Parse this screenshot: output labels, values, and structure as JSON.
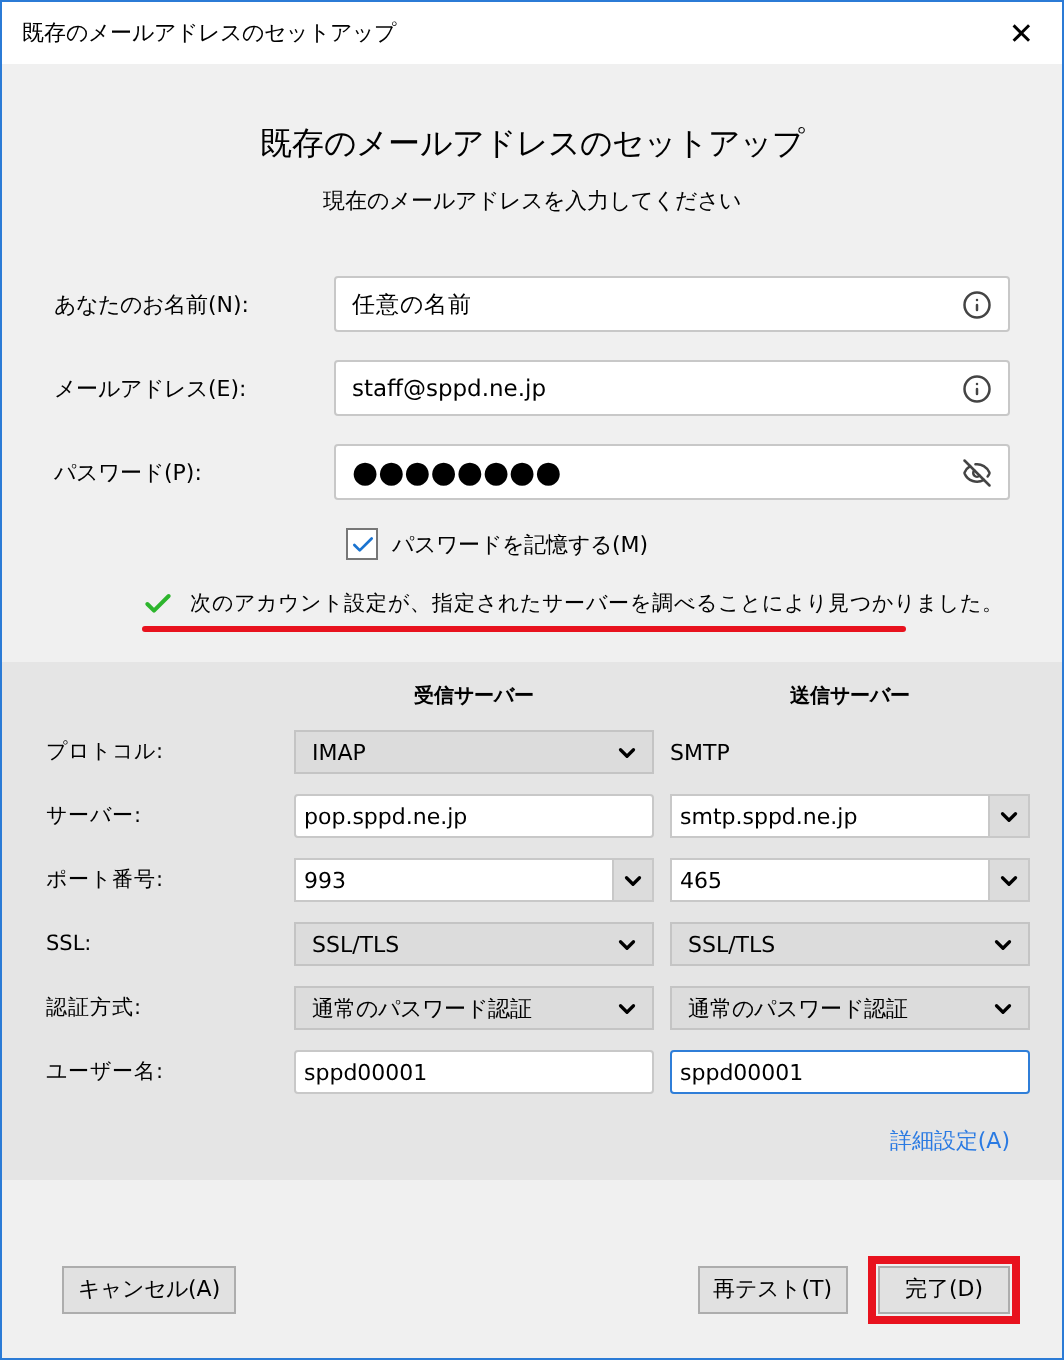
{
  "window": {
    "title": "既存のメールアドレスのセットアップ",
    "close": "✕"
  },
  "heading": "既存のメールアドレスのセットアップ",
  "subheading": "現在のメールアドレスを入力してください",
  "fields": [
    {
      "label": "あなたのお名前(N):",
      "value": "任意の名前",
      "kind": "text"
    },
    {
      "label": "メールアドレス(E):",
      "value": "staff@sppd.ne.jp",
      "kind": "text"
    },
    {
      "label": "パスワード(P):",
      "value": "●●●●●●●●",
      "kind": "password"
    }
  ],
  "remember": {
    "label": "パスワードを記憶する(M)",
    "checked": true
  },
  "status": {
    "text": "次のアカウント設定が、指定されたサーバーを調べることにより見つかりました。",
    "highlighted": true
  },
  "servers": {
    "columns": [
      "受信サーバー",
      "送信サーバー"
    ],
    "rows": [
      {
        "label": "プロトコル:",
        "incoming": {
          "kind": "select",
          "value": "IMAP"
        },
        "outgoing": {
          "kind": "text",
          "value": "SMTP"
        }
      },
      {
        "label": "サーバー:",
        "incoming": {
          "kind": "input",
          "value": "pop.sppd.ne.jp"
        },
        "outgoing": {
          "kind": "combo",
          "value": "smtp.sppd.ne.jp"
        }
      },
      {
        "label": "ポート番号:",
        "incoming": {
          "kind": "combo",
          "value": "993"
        },
        "outgoing": {
          "kind": "combo",
          "value": "465"
        }
      },
      {
        "label": "SSL:",
        "incoming": {
          "kind": "select",
          "value": "SSL/TLS"
        },
        "outgoing": {
          "kind": "select",
          "value": "SSL/TLS"
        }
      },
      {
        "label": "認証方式:",
        "incoming": {
          "kind": "select",
          "value": "通常のパスワード認証"
        },
        "outgoing": {
          "kind": "select",
          "value": "通常のパスワード認証"
        }
      },
      {
        "label": "ユーザー名:",
        "incoming": {
          "kind": "input",
          "value": "sppd00001",
          "focused": false
        },
        "outgoing": {
          "kind": "input",
          "value": "sppd00001",
          "focused": true
        }
      }
    ],
    "advanced_link": "詳細設定(A)"
  },
  "buttons": [
    {
      "label": "キャンセル(A)",
      "highlighted": false
    },
    {
      "label": "再テスト(T)",
      "highlighted": false
    },
    {
      "label": "完了(D)",
      "highlighted": true
    }
  ]
}
